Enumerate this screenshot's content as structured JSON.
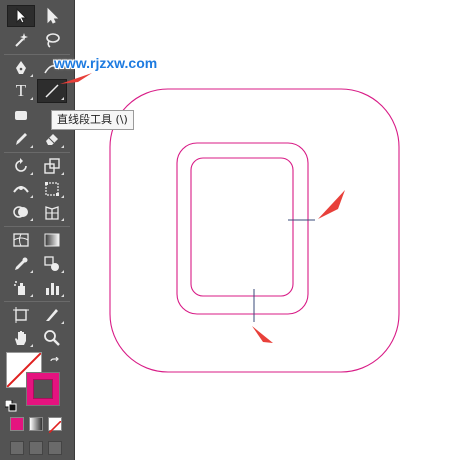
{
  "watermark": "www.rjzxw.com",
  "tooltip": {
    "text": "直线段工具 (\\)"
  },
  "tools": [
    {
      "name": "selection-tool",
      "icon": "arrow-icon"
    },
    {
      "name": "direct-selection-tool",
      "icon": "hollow-arrow-icon"
    },
    {
      "name": "magic-wand-tool",
      "icon": "magic-wand-icon"
    },
    {
      "name": "lasso-tool",
      "icon": "lasso-icon"
    },
    {
      "name": "pen-tool",
      "icon": "pen-icon"
    },
    {
      "name": "curvature-tool",
      "icon": "curvature-icon"
    },
    {
      "name": "type-tool",
      "icon": "type-icon",
      "glyph": "T"
    },
    {
      "name": "line-segment-tool",
      "icon": "line-segment-icon",
      "selected": true
    },
    {
      "name": "rectangle-tool",
      "icon": "rectangle-icon"
    },
    {
      "name": "pencil-tool",
      "icon": "pencil-icon"
    },
    {
      "name": "eraser-tool",
      "icon": "eraser-icon"
    },
    {
      "name": "rotate-tool",
      "icon": "rotate-icon"
    },
    {
      "name": "scale-tool",
      "icon": "scale-icon"
    },
    {
      "name": "width-tool",
      "icon": "width-icon"
    },
    {
      "name": "free-transform-tool",
      "icon": "free-transform-icon"
    },
    {
      "name": "shape-builder-tool",
      "icon": "shape-builder-icon"
    },
    {
      "name": "perspective-grid-tool",
      "icon": "perspective-grid-icon"
    },
    {
      "name": "mesh-tool",
      "icon": "mesh-icon"
    },
    {
      "name": "gradient-tool",
      "icon": "gradient-icon"
    },
    {
      "name": "eyedropper-tool",
      "icon": "eyedropper-icon"
    },
    {
      "name": "blend-tool",
      "icon": "blend-icon"
    },
    {
      "name": "symbol-sprayer-tool",
      "icon": "symbol-sprayer-icon"
    },
    {
      "name": "column-graph-tool",
      "icon": "column-graph-icon"
    },
    {
      "name": "artboard-tool",
      "icon": "artboard-icon"
    },
    {
      "name": "slice-tool",
      "icon": "slice-icon"
    },
    {
      "name": "hand-tool",
      "icon": "hand-icon"
    },
    {
      "name": "zoom-tool",
      "icon": "zoom-icon"
    }
  ],
  "colors": {
    "stroke_color": "#e5137f",
    "artwork_stroke": "#d81b86",
    "arrow_color": "#e8403a",
    "panel_bg": "#535353",
    "watermark_color": "#1e7be0"
  }
}
